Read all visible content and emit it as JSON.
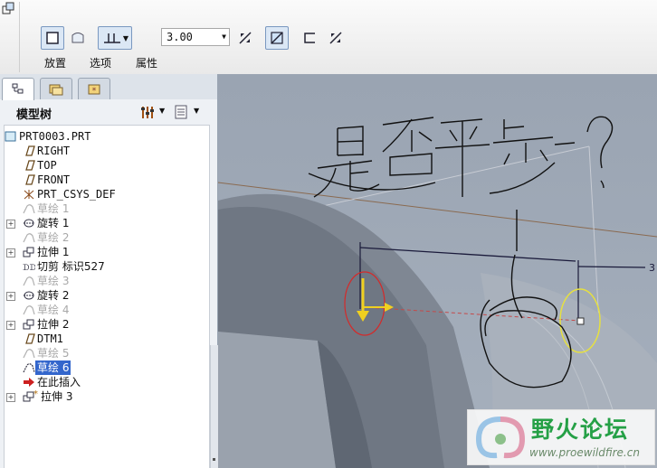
{
  "toolbar": {
    "labels": [
      "放置",
      "选项",
      "属性"
    ],
    "value_combo": "3.00"
  },
  "tree": {
    "title": "模型树",
    "items": [
      {
        "label": "PRT0003.PRT"
      },
      {
        "label": "RIGHT"
      },
      {
        "label": "TOP"
      },
      {
        "label": "FRONT"
      },
      {
        "label": "PRT_CSYS_DEF"
      },
      {
        "label": "草绘 1"
      },
      {
        "label": "旋转 1"
      },
      {
        "label": "草绘 2"
      },
      {
        "label": "拉伸 1"
      },
      {
        "label": "切剪 标识527"
      },
      {
        "label": "草绘 3"
      },
      {
        "label": "旋转 2"
      },
      {
        "label": "草绘 4"
      },
      {
        "label": "拉伸 2"
      },
      {
        "label": "DTM1"
      },
      {
        "label": "草绘 5"
      },
      {
        "label": "草绘 6"
      },
      {
        "label": "在此插入"
      },
      {
        "label": "拉伸 3"
      }
    ]
  },
  "viewport": {
    "dimension_value": "3",
    "background_color": "#9aa4b2"
  },
  "watermark": {
    "title": "野火论坛",
    "url": "www.proewildfire.cn"
  }
}
